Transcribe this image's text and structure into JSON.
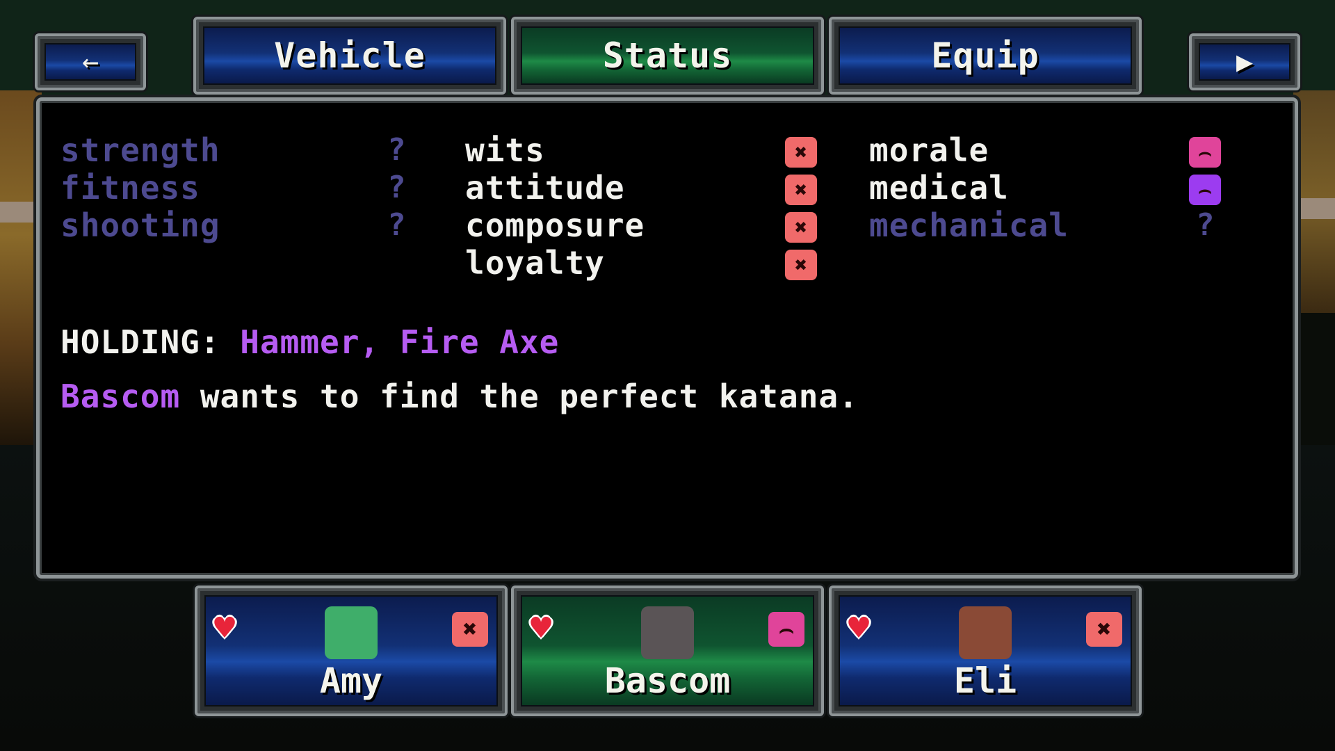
{
  "nav": {
    "back_icon": "back-arrow-icon",
    "forward_icon": "play-arrow-icon",
    "back_glyph": "←",
    "forward_glyph": "▶"
  },
  "tabs": [
    {
      "label": "Vehicle",
      "active": false
    },
    {
      "label": "Status",
      "active": true
    },
    {
      "label": "Equip",
      "active": false
    }
  ],
  "stats": {
    "column1": [
      {
        "name": "strength",
        "known": false,
        "value": "?"
      },
      {
        "name": "fitness",
        "known": false,
        "value": "?"
      },
      {
        "name": "shooting",
        "known": false,
        "value": "?"
      }
    ],
    "column2": [
      {
        "name": "wits",
        "known": true,
        "face": "angry-face-icon",
        "color": "#f06a6a"
      },
      {
        "name": "attitude",
        "known": true,
        "face": "angry-face-icon",
        "color": "#f06a6a"
      },
      {
        "name": "composure",
        "known": true,
        "face": "angry-face-icon",
        "color": "#f06a6a"
      },
      {
        "name": "loyalty",
        "known": true,
        "face": "angry-face-icon",
        "color": "#f06a6a"
      }
    ],
    "column3": [
      {
        "name": "morale",
        "known": true,
        "face": "sad-face-icon",
        "color": "#e0449a"
      },
      {
        "name": "medical",
        "known": true,
        "face": "sad-face-icon",
        "color": "#9c3cf0"
      },
      {
        "name": "mechanical",
        "known": false,
        "value": "?"
      }
    ]
  },
  "holding": {
    "label": "HOLDING:",
    "items": "Hammer, Fire Axe"
  },
  "goal": {
    "name": "Bascom",
    "text": " wants to find the perfect katana."
  },
  "party": [
    {
      "name": "Amy",
      "active": false,
      "mood_icon": "angry-face-icon",
      "mood_color": "#f06a6a",
      "portrait_color": "#3fae6a"
    },
    {
      "name": "Bascom",
      "active": true,
      "mood_icon": "sad-face-icon",
      "mood_color": "#e0449a",
      "portrait_color": "#5a5456"
    },
    {
      "name": "Eli",
      "active": false,
      "mood_icon": "angry-face-icon",
      "mood_color": "#f06a6a",
      "portrait_color": "#8a4a36"
    }
  ],
  "glyphs": {
    "angry": "✖",
    "sad": "⌢",
    "heart": "♥"
  }
}
